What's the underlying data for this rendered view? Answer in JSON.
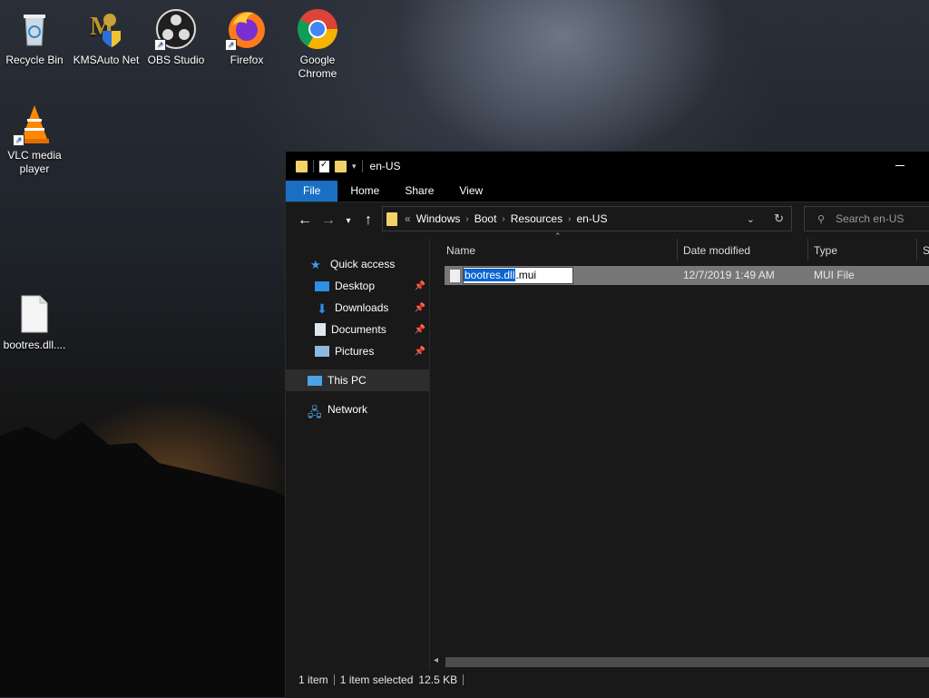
{
  "desktop": {
    "icons": [
      {
        "label": "Recycle Bin",
        "icon": "recycle-bin-icon"
      },
      {
        "label": "KMSAuto Net",
        "icon": "kmsauto-icon"
      },
      {
        "label": "OBS Studio",
        "icon": "obs-icon"
      },
      {
        "label": "Firefox",
        "icon": "firefox-icon"
      },
      {
        "label": "Google Chrome",
        "icon": "chrome-icon"
      },
      {
        "label": "VLC media player",
        "icon": "vlc-icon"
      },
      {
        "label": "bootres.dll....",
        "icon": "file-icon"
      }
    ]
  },
  "explorer": {
    "title": "en-US",
    "ribbon_tabs": [
      "File",
      "Home",
      "Share",
      "View"
    ],
    "address": {
      "overflow": "«",
      "crumbs": [
        "Windows",
        "Boot",
        "Resources",
        "en-US"
      ]
    },
    "search_placeholder": "Search en-US",
    "nav": {
      "quick_access": "Quick access",
      "desktop": "Desktop",
      "downloads": "Downloads",
      "documents": "Documents",
      "pictures": "Pictures",
      "this_pc": "This PC",
      "network": "Network"
    },
    "columns": {
      "name": "Name",
      "date": "Date modified",
      "type": "Type",
      "size": "S"
    },
    "file": {
      "name_selected": "bootres.dll",
      "name_ext": ".mui",
      "date": "12/7/2019 1:49 AM",
      "type": "MUI File"
    },
    "status": {
      "items": "1 item",
      "selected": "1 item selected",
      "size": "12.5 KB"
    }
  },
  "colors": {
    "accent": "#1a6fc4",
    "folder": "#f3d26a"
  }
}
